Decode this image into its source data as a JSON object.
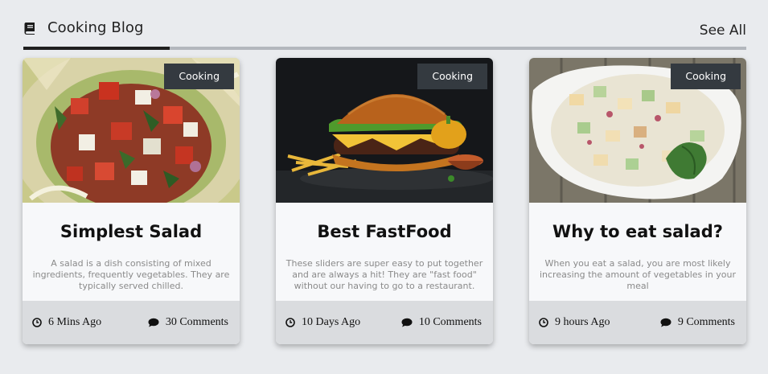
{
  "header": {
    "title": "Cooking Blog",
    "see_all": "See All",
    "icon": "book-icon"
  },
  "colors": {
    "background": "#e9ebee",
    "badge": "#343a40",
    "footer": "#dadcdf",
    "card": "#f7f8fa"
  },
  "cards": [
    {
      "badge": "Cooking",
      "title": "Simplest Salad",
      "description": "A salad is a dish consisting of mixed ingredients, frequently vegetables. They are typically served chilled.",
      "time": "6 Mins Ago",
      "comments": "30 Comments",
      "image": "tomato-onion-salad-bowl"
    },
    {
      "badge": "Cooking",
      "title": "Best FastFood",
      "description": "These sliders are super easy to put together and are always a hit! They are \"fast food\" without our having to go to a restaurant.",
      "time": "10 Days Ago",
      "comments": "10 Comments",
      "image": "burger-fries-dark"
    },
    {
      "badge": "Cooking",
      "title": "Why to eat salad?",
      "description": "When you eat a salad, you are most likely increasing the amount of vegetables in your meal",
      "time": "9 hours Ago",
      "comments": "9 Comments",
      "image": "creamy-salad-dish"
    }
  ]
}
